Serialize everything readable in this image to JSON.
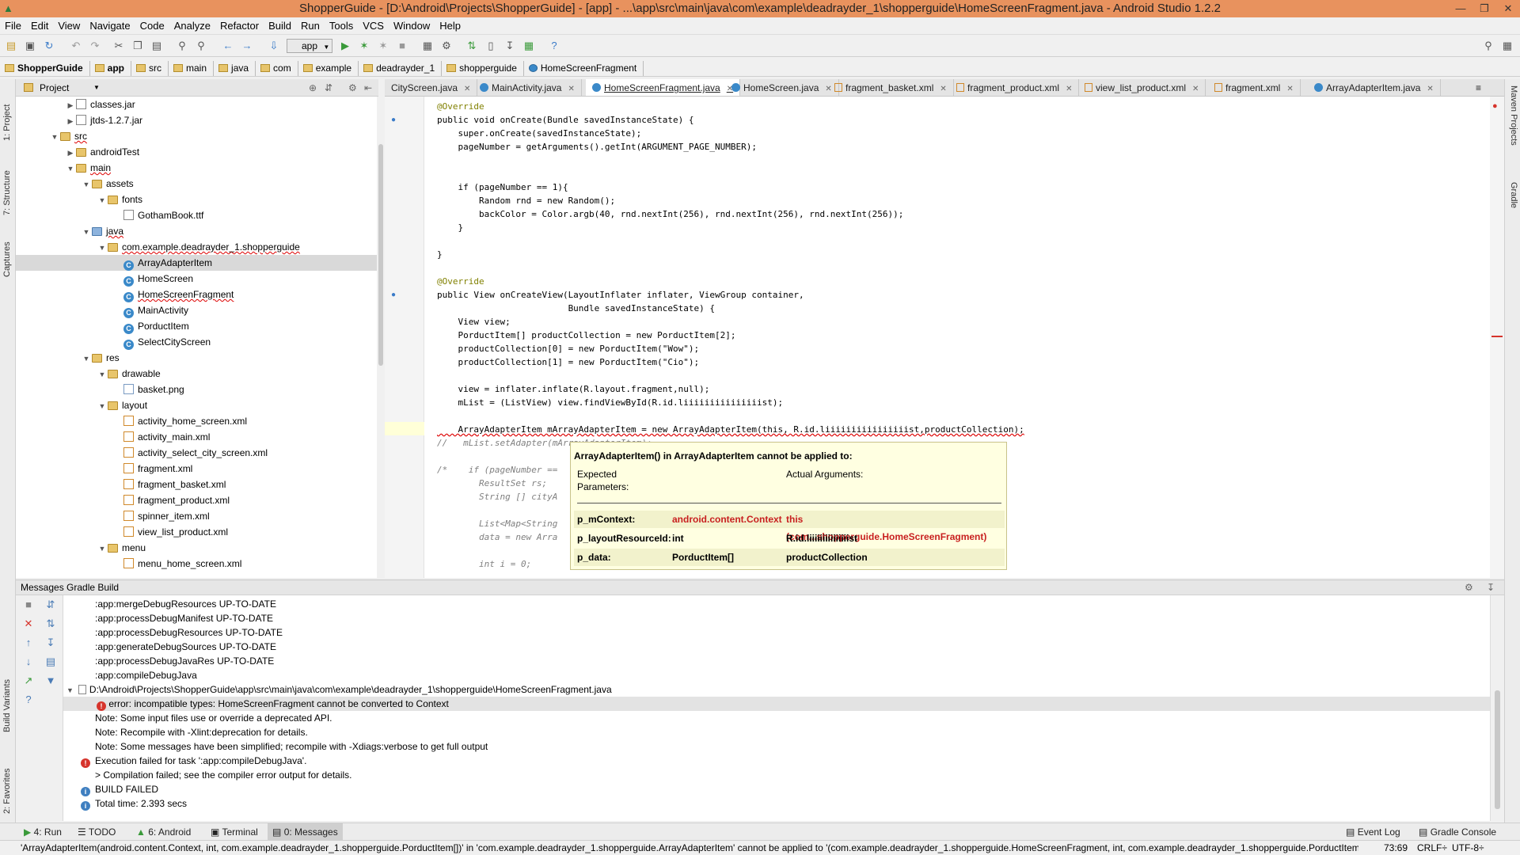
{
  "window": {
    "title": "ShopperGuide - [D:\\Android\\Projects\\ShopperGuide] - [app] - ...\\app\\src\\main\\java\\com\\example\\deadrayder_1\\shopperguide\\HomeScreenFragment.java - Android Studio 1.2.2"
  },
  "menu": [
    "File",
    "Edit",
    "View",
    "Navigate",
    "Code",
    "Analyze",
    "Refactor",
    "Build",
    "Run",
    "Tools",
    "VCS",
    "Window",
    "Help"
  ],
  "toolbar": {
    "run_config": "app"
  },
  "breadcrumb": [
    "ShopperGuide",
    "app",
    "src",
    "main",
    "java",
    "com",
    "example",
    "deadrayder_1",
    "shopperguide",
    "HomeScreenFragment"
  ],
  "left_strip": [
    "1: Project",
    "7: Structure",
    "Captures",
    "Build Variants",
    "2: Favorites"
  ],
  "right_strip": [
    "Maven Projects",
    "Gradle"
  ],
  "project_panel": {
    "title": "Project",
    "tree": [
      {
        "label": "classes.jar",
        "icon": "jar-icon"
      },
      {
        "label": "jtds-1.2.7.jar",
        "icon": "jar-icon"
      },
      {
        "label": "src",
        "icon": "folder-icon"
      },
      {
        "label": "androidTest",
        "icon": "folder-icon"
      },
      {
        "label": "main",
        "icon": "folder-icon"
      },
      {
        "label": "assets",
        "icon": "folder-icon"
      },
      {
        "label": "fonts",
        "icon": "folder-icon"
      },
      {
        "label": "GothamBook.ttf",
        "icon": "file-icon"
      },
      {
        "label": "java",
        "icon": "folder-icon"
      },
      {
        "label": "com.example.deadrayder_1.shopperguide",
        "icon": "package-icon"
      },
      {
        "label": "ArrayAdapterItem",
        "icon": "class-icon"
      },
      {
        "label": "HomeScreen",
        "icon": "class-icon"
      },
      {
        "label": "HomeScreenFragment",
        "icon": "class-icon"
      },
      {
        "label": "MainActivity",
        "icon": "class-icon"
      },
      {
        "label": "PorductItem",
        "icon": "class-icon"
      },
      {
        "label": "SelectCityScreen",
        "icon": "class-icon"
      },
      {
        "label": "res",
        "icon": "folder-icon"
      },
      {
        "label": "drawable",
        "icon": "folder-icon"
      },
      {
        "label": "basket.png",
        "icon": "image-icon"
      },
      {
        "label": "layout",
        "icon": "folder-icon"
      },
      {
        "label": "activity_home_screen.xml",
        "icon": "xml-icon"
      },
      {
        "label": "activity_main.xml",
        "icon": "xml-icon"
      },
      {
        "label": "activity_select_city_screen.xml",
        "icon": "xml-icon"
      },
      {
        "label": "fragment.xml",
        "icon": "xml-icon"
      },
      {
        "label": "fragment_basket.xml",
        "icon": "xml-icon"
      },
      {
        "label": "fragment_product.xml",
        "icon": "xml-icon"
      },
      {
        "label": "spinner_item.xml",
        "icon": "xml-icon"
      },
      {
        "label": "view_list_product.xml",
        "icon": "xml-icon"
      },
      {
        "label": "menu",
        "icon": "folder-icon"
      },
      {
        "label": "menu_home_screen.xml",
        "icon": "xml-icon"
      }
    ]
  },
  "editor_tabs": [
    "CityScreen.java",
    "MainActivity.java",
    "HomeScreenFragment.java",
    "HomeScreen.java",
    "fragment_basket.xml",
    "fragment_product.xml",
    "view_list_product.xml",
    "fragment.xml",
    "ArrayAdapterItem.java"
  ],
  "code_lines": [
    "@Override",
    "public void onCreate(Bundle savedInstanceState) {",
    "    super.onCreate(savedInstanceState);",
    "    pageNumber = getArguments().getInt(ARGUMENT_PAGE_NUMBER);",
    "",
    "",
    "    if (pageNumber == 1){",
    "        Random rnd = new Random();",
    "        backColor = Color.argb(40, rnd.nextInt(256), rnd.nextInt(256), rnd.nextInt(256));",
    "    }",
    "",
    "}",
    "",
    "@Override",
    "public View onCreateView(LayoutInflater inflater, ViewGroup container,",
    "                         Bundle savedInstanceState) {",
    "    View view;",
    "    PorductItem[] productCollection = new PorductItem[2];",
    "    productCollection[0] = new PorductItem(\"Wow\");",
    "    productCollection[1] = new PorductItem(\"Cio\");",
    "",
    "    view = inflater.inflate(R.layout.fragment,null);",
    "    mList = (ListView) view.findViewById(R.id.liiiiiiiiiiiiiiist);",
    "",
    "    ArrayAdapterItem mArrayAdapterItem = new ArrayAdapterItem(this, R.id.liiiiiiiiiiiiiiiist,productCollection);",
    "//   mList.setAdapter(mArrayAdapterItem);",
    "",
    "/*    if (pageNumber ==",
    "        ResultSet rs;",
    "        String [] cityA",
    "",
    "        List<Map<String",
    "        data = new Arra",
    "",
    "        int i = 0;",
    "        ..."
  ],
  "tooltip": {
    "title": "ArrayAdapterItem() in ArrayAdapterItem cannot be applied to:",
    "col_expected": "Expected Parameters:",
    "col_actual": "Actual Arguments:",
    "rows": [
      {
        "name": "p_mContext:",
        "type": "android.content.Context",
        "arg": "this  (com...shopperguide.HomeScreenFragment)"
      },
      {
        "name": "p_layoutResourceId:",
        "type": "int",
        "arg": "R.id.liiiiiiiiiiiiiiist"
      },
      {
        "name": "p_data:",
        "type": "PorductItem[]",
        "arg": "productCollection"
      }
    ]
  },
  "messages_panel": {
    "title": "Messages Gradle Build",
    "lines": [
      {
        "text": ":app:mergeDebugResources UP-TO-DATE",
        "icon": ""
      },
      {
        "text": ":app:processDebugManifest UP-TO-DATE",
        "icon": ""
      },
      {
        "text": ":app:processDebugResources UP-TO-DATE",
        "icon": ""
      },
      {
        "text": ":app:generateDebugSources UP-TO-DATE",
        "icon": ""
      },
      {
        "text": ":app:processDebugJavaRes UP-TO-DATE",
        "icon": ""
      },
      {
        "text": ":app:compileDebugJava",
        "icon": ""
      },
      {
        "text": "D:\\Android\\Projects\\ShopperGuide\\app\\src\\main\\java\\com\\example\\deadrayder_1\\shopperguide\\HomeScreenFragment.java",
        "icon": "file"
      },
      {
        "text": "error: incompatible types: HomeScreenFragment cannot be converted to Context",
        "icon": "error"
      },
      {
        "text": "Note: Some input files use or override a deprecated API.",
        "icon": ""
      },
      {
        "text": "Note: Recompile with -Xlint:deprecation for details.",
        "icon": ""
      },
      {
        "text": "Note: Some messages have been simplified; recompile with -Xdiags:verbose to get full output",
        "icon": ""
      },
      {
        "text": "Execution failed for task ':app:compileDebugJava'.",
        "icon": "error"
      },
      {
        "text": "> Compilation failed; see the compiler error output for details.",
        "icon": ""
      },
      {
        "text": "BUILD FAILED",
        "icon": "info"
      },
      {
        "text": "Total time: 2.393 secs",
        "icon": "info"
      }
    ]
  },
  "bottom_tools": [
    "4: Run",
    "TODO",
    "6: Android",
    "Terminal",
    "0: Messages",
    "Event Log",
    "Gradle Console"
  ],
  "status": {
    "message": "'ArrayAdapterItem(android.content.Context, int, com.example.deadrayder_1.shopperguide.PorductItem[])' in 'com.example.deadrayder_1.shopperguide.ArrayAdapterItem' cannot be applied to '(com.example.deadrayder_1.shopperguide.HomeScreenFragment, int, com.example.deadrayder_1.shopperguide.PorductItem[])'",
    "position": "73:69",
    "line_sep": "CRLF÷",
    "encoding": "UTF-8÷"
  },
  "colors": {
    "titlebar": "#e8925e",
    "error": "#d6342c",
    "selection": "#d9d9d9"
  }
}
